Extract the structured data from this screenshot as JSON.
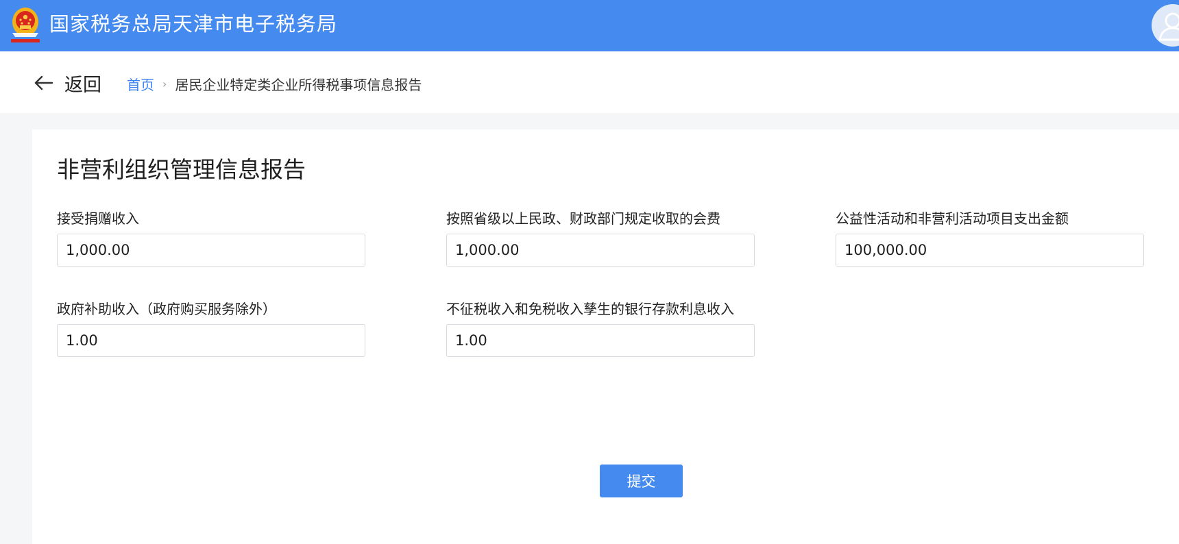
{
  "header": {
    "title": "国家税务总局天津市电子税务局",
    "logo_icon": "tax-emblem-icon",
    "avatar_icon": "user-icon"
  },
  "nav": {
    "back_label": "返回",
    "back_icon": "arrow-left-icon",
    "breadcrumb": {
      "home": "首页",
      "separator": "›",
      "current": "居民企业特定类企业所得税事项信息报告"
    }
  },
  "form": {
    "title": "非营利组织管理信息报告",
    "fields": [
      {
        "label": "接受捐赠收入",
        "value": "1,000.00"
      },
      {
        "label": "按照省级以上民政、财政部门规定收取的会费",
        "value": "1,000.00"
      },
      {
        "label": "公益性活动和非营利活动项目支出金额",
        "value": "100,000.00"
      },
      {
        "label": "政府补助收入（政府购买服务除外）",
        "value": "1.00"
      },
      {
        "label": "不征税收入和免税收入孳生的银行存款利息收入",
        "value": "1.00"
      }
    ],
    "submit_label": "提交"
  },
  "colors": {
    "primary": "#448aef",
    "link": "#3b82f0",
    "page_bg": "#f5f6f8",
    "card_bg": "#ffffff"
  }
}
